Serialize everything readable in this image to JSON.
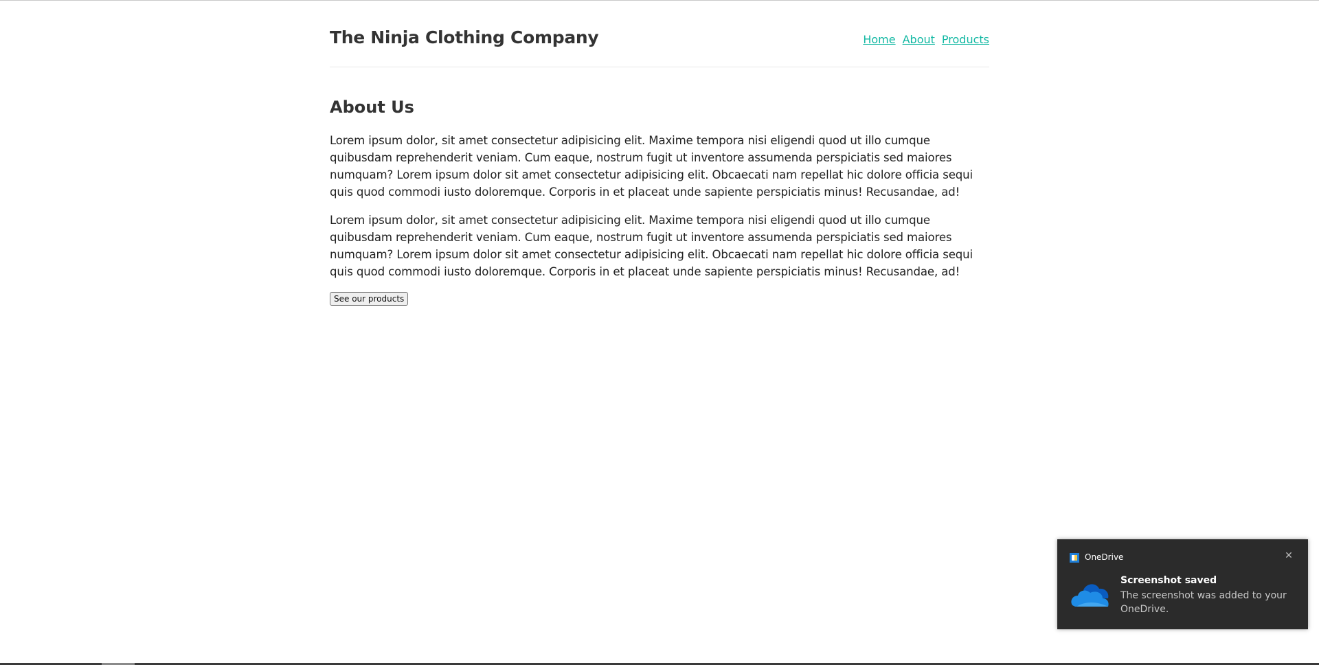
{
  "site": {
    "title": "The Ninja Clothing Company",
    "nav": [
      "Home",
      "About",
      "Products"
    ]
  },
  "main": {
    "heading": "About Us",
    "paragraphs": [
      "Lorem ipsum dolor, sit amet consectetur adipisicing elit. Maxime tempora nisi eligendi quod ut illo cumque quibusdam reprehenderit veniam. Cum eaque, nostrum fugit ut inventore assumenda perspiciatis sed maiores numquam? Lorem ipsum dolor sit amet consectetur adipisicing elit. Obcaecati nam repellat hic dolore officia sequi quis quod commodi iusto doloremque. Corporis in et placeat unde sapiente perspiciatis minus! Recusandae, ad!",
      "Lorem ipsum dolor, sit amet consectetur adipisicing elit. Maxime tempora nisi eligendi quod ut illo cumque quibusdam reprehenderit veniam. Cum eaque, nostrum fugit ut inventore assumenda perspiciatis sed maiores numquam? Lorem ipsum dolor sit amet consectetur adipisicing elit. Obcaecati nam repellat hic dolore officia sequi quis quod commodi iusto doloremque. Corporis in et placeat unde sapiente perspiciatis minus! Recusandae, ad!"
    ],
    "button_label": "See our products"
  },
  "toast": {
    "app_name": "OneDrive",
    "title": "Screenshot saved",
    "body": "The screenshot was added to your OneDrive.",
    "close_glyph": "✕"
  },
  "colors": {
    "link": "#12b8a3",
    "toast_bg": "#2b2b2b",
    "onedrive_blue": "#1f7fd8"
  }
}
